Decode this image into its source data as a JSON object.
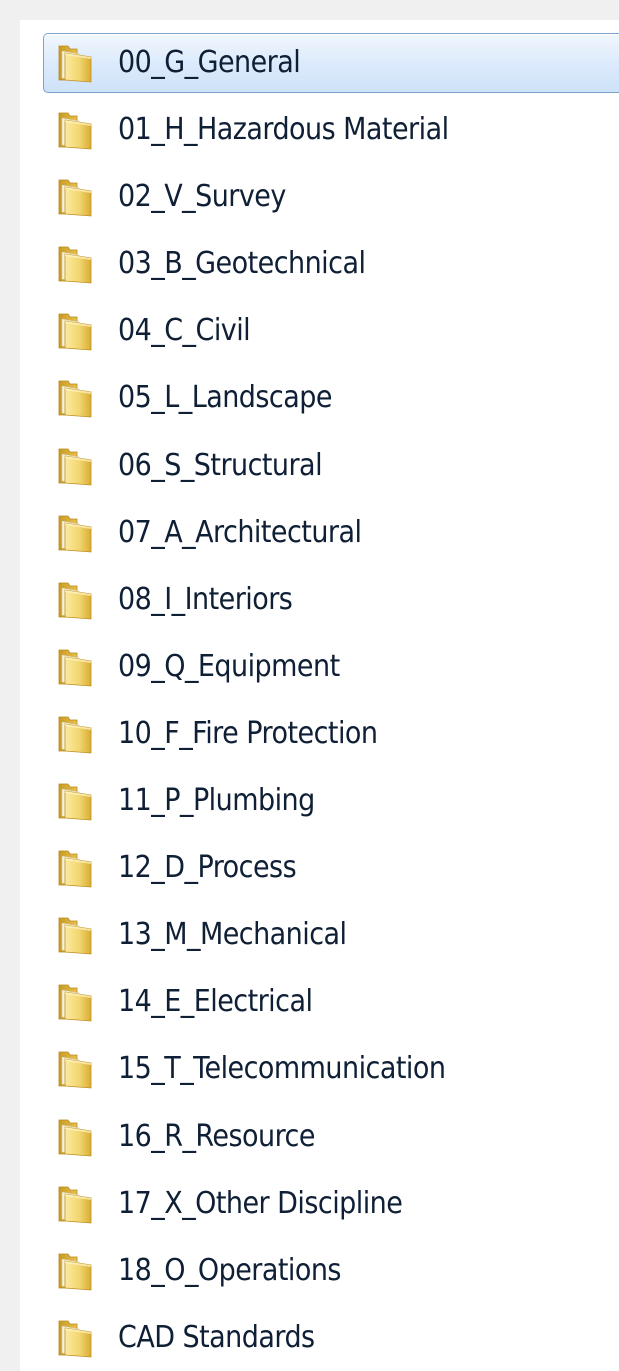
{
  "folders": [
    {
      "label": "00_G_General",
      "selected": true
    },
    {
      "label": "01_H_Hazardous Material",
      "selected": false
    },
    {
      "label": "02_V_Survey",
      "selected": false
    },
    {
      "label": "03_B_Geotechnical",
      "selected": false
    },
    {
      "label": "04_C_Civil",
      "selected": false
    },
    {
      "label": "05_L_Landscape",
      "selected": false
    },
    {
      "label": "06_S_Structural",
      "selected": false
    },
    {
      "label": "07_A_Architectural",
      "selected": false
    },
    {
      "label": "08_I_Interiors",
      "selected": false
    },
    {
      "label": "09_Q_Equipment",
      "selected": false
    },
    {
      "label": "10_F_Fire Protection",
      "selected": false
    },
    {
      "label": "11_P_Plumbing",
      "selected": false
    },
    {
      "label": "12_D_Process",
      "selected": false
    },
    {
      "label": "13_M_Mechanical",
      "selected": false
    },
    {
      "label": "14_E_Electrical",
      "selected": false
    },
    {
      "label": "15_T_Telecommunication",
      "selected": false
    },
    {
      "label": "16_R_Resource",
      "selected": false
    },
    {
      "label": "17_X_Other Discipline",
      "selected": false
    },
    {
      "label": "18_O_Operations",
      "selected": false
    },
    {
      "label": "CAD Standards",
      "selected": false
    }
  ],
  "icon": "folder-icon",
  "colors": {
    "folder_body": "#eac84c",
    "folder_light": "#fbeaa0",
    "folder_dark": "#c89a26",
    "selection_border": "#7da2ce",
    "selection_fill": "#dcebfc",
    "text": "#0f1f35"
  }
}
